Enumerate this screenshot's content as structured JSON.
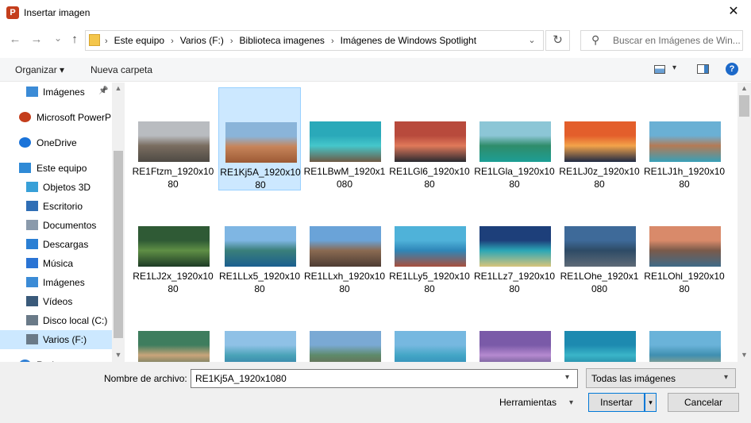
{
  "window": {
    "title": "Insertar imagen",
    "app_icon_letter": "P",
    "close_glyph": "✕"
  },
  "nav_buttons": {
    "back": "←",
    "forward": "→",
    "recent": "⌄",
    "up": "↑"
  },
  "address": {
    "crumbs": [
      "Este equipo",
      "Varios (F:)",
      "Biblioteca imagenes",
      "Imágenes de Windows Spotlight"
    ],
    "separator": "›",
    "refresh": "↻",
    "dropdown": "⌄"
  },
  "search": {
    "placeholder": "Buscar en Imágenes de Win...",
    "icon": "⚲"
  },
  "toolbar": {
    "organize_label": "Organizar ▾",
    "new_folder_label": "Nueva carpeta",
    "view_dropdown": "▾",
    "help_label": "?"
  },
  "sidebar": {
    "items": [
      {
        "label": "Imágenes",
        "icon": "pictures-icon",
        "pinned": true
      },
      {
        "label": "Microsoft PowerP",
        "icon": "powerpoint-icon"
      },
      {
        "label": "OneDrive",
        "icon": "onedrive-icon"
      },
      {
        "label": "Este equipo",
        "icon": "computer-icon"
      },
      {
        "label": "Objetos 3D",
        "icon": "objects3d-icon"
      },
      {
        "label": "Escritorio",
        "icon": "desktop-icon"
      },
      {
        "label": "Documentos",
        "icon": "documents-icon"
      },
      {
        "label": "Descargas",
        "icon": "downloads-icon"
      },
      {
        "label": "Música",
        "icon": "music-icon"
      },
      {
        "label": "Imágenes",
        "icon": "pictures-icon"
      },
      {
        "label": "Vídeos",
        "icon": "videos-icon"
      },
      {
        "label": "Disco local (C:)",
        "icon": "drive-icon"
      },
      {
        "label": "Varios (F:)",
        "icon": "drive-icon",
        "selected": true
      },
      {
        "label": "Red",
        "icon": "network-icon"
      }
    ],
    "pin_glyph": "📌"
  },
  "files": [
    {
      "name": "RE1Ftzm_1920x1080",
      "colors": [
        "#b9bcc0",
        "#7a6d60",
        "#4e4a44"
      ]
    },
    {
      "name": "RE1Kj5A_1920x1080",
      "colors": [
        "#8ab4d9",
        "#c7845a",
        "#9c5a35"
      ],
      "selected": true
    },
    {
      "name": "RE1LBwM_1920x1080",
      "colors": [
        "#2aa9b9",
        "#45c7cb",
        "#6e5a45"
      ]
    },
    {
      "name": "RE1LGl6_1920x1080",
      "colors": [
        "#b84a3c",
        "#e0795a",
        "#2a2a30"
      ]
    },
    {
      "name": "RE1LGla_1920x1080",
      "colors": [
        "#8cc6d6",
        "#2f8c6a",
        "#1d9e95"
      ]
    },
    {
      "name": "RE1LJ0z_1920x1080",
      "colors": [
        "#e35e2b",
        "#f3a34a",
        "#1f2a44"
      ]
    },
    {
      "name": "RE1LJ1h_1920x1080",
      "colors": [
        "#6ab0d4",
        "#b47a55",
        "#38a0b8"
      ]
    },
    {
      "name": "RE1LJ2x_1920x1080",
      "colors": [
        "#2f5a35",
        "#5f8f45",
        "#1d3b26"
      ]
    },
    {
      "name": "RE1LLx5_1920x1080",
      "colors": [
        "#7fb6e3",
        "#3a7f7a",
        "#1b5f8f"
      ]
    },
    {
      "name": "RE1LLxh_1920x1080",
      "colors": [
        "#6aa3d8",
        "#8a6a52",
        "#4d3c33"
      ]
    },
    {
      "name": "RE1LLy5_1920x1080",
      "colors": [
        "#4fb2d9",
        "#2f86b8",
        "#a84f3d"
      ]
    },
    {
      "name": "RE1LLz7_1920x1080",
      "colors": [
        "#1d3f7a",
        "#2aa6b6",
        "#d8c47a"
      ]
    },
    {
      "name": "RE1LOhe_1920x1080",
      "colors": [
        "#3e6a99",
        "#2e4b66",
        "#5e6a77"
      ]
    },
    {
      "name": "RE1LOhl_1920x1080",
      "colors": [
        "#d98a6a",
        "#7a5a4a",
        "#3f6a88"
      ]
    },
    {
      "name": "",
      "colors": [
        "#3e7d5e",
        "#c9a57a",
        "#2d5d4a"
      ]
    },
    {
      "name": "",
      "colors": [
        "#8fc1e6",
        "#4aa3b8",
        "#2b6fa0"
      ]
    },
    {
      "name": "",
      "colors": [
        "#7aa9d4",
        "#5e8a6a",
        "#6d5a4a"
      ]
    },
    {
      "name": "",
      "colors": [
        "#76b8e0",
        "#43a6c6",
        "#2a7fb0"
      ]
    },
    {
      "name": "",
      "colors": [
        "#7a5aa8",
        "#b58ad0",
        "#3a3a6a"
      ]
    },
    {
      "name": "",
      "colors": [
        "#1d8ab0",
        "#3ab5c8",
        "#156a8f"
      ]
    },
    {
      "name": "",
      "colors": [
        "#6ab3d9",
        "#3f8fb0",
        "#c7b07a"
      ]
    }
  ],
  "bottom": {
    "filename_label": "Nombre de archivo:",
    "filename_value": "RE1Kj5A_1920x1080",
    "filter_value": "Todas las imágenes",
    "tools_label": "Herramientas",
    "insert_label": "Insertar",
    "cancel_label": "Cancelar",
    "dropdown_glyph": "▾"
  }
}
